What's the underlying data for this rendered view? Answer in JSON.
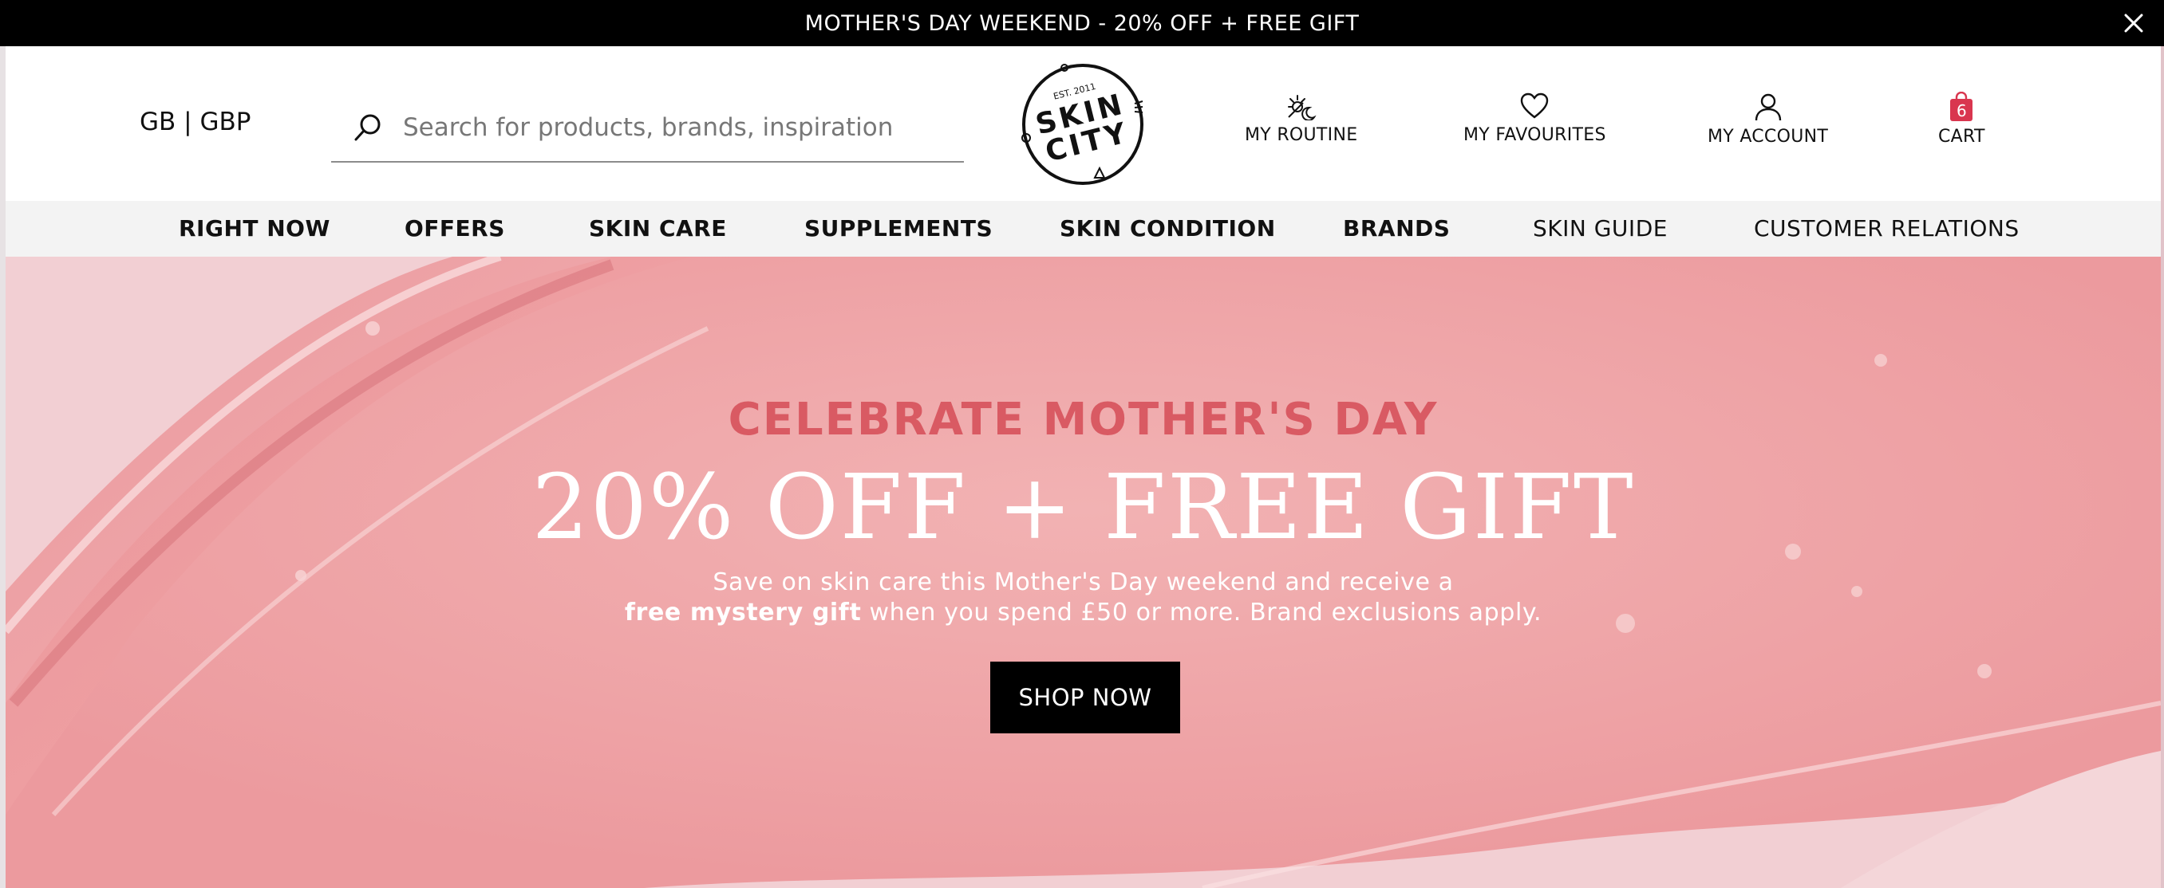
{
  "announcement": {
    "text": "MOTHER'S DAY WEEKEND - 20% OFF + FREE GIFT",
    "close_icon": "close-icon"
  },
  "header": {
    "locale": "GB | GBP",
    "search": {
      "placeholder": "Search for products, brands, inspiration",
      "value": "",
      "icon": "search-icon"
    },
    "logo": {
      "top_text": "EST. 2011",
      "line1": "SKIN",
      "line2": "CITY"
    },
    "links": {
      "routine": "MY ROUTINE",
      "favourites": "MY FAVOURITES",
      "account": "MY ACCOUNT",
      "cart": "CART"
    },
    "cart_count": "6",
    "icons": {
      "routine": "sun-moon-icon",
      "favourites": "heart-icon",
      "account": "user-icon",
      "cart": "shopping-bag-icon"
    }
  },
  "nav": {
    "items": [
      "RIGHT NOW",
      "OFFERS",
      "SKIN CARE",
      "SUPPLEMENTS",
      "SKIN CONDITION",
      "BRANDS",
      "SKIN GUIDE",
      "CUSTOMER RELATIONS"
    ]
  },
  "hero": {
    "eyebrow": "CELEBRATE MOTHER'S DAY",
    "headline": "20% OFF + FREE GIFT",
    "sub_line1": "Save on skin care this Mother's Day weekend and receive a",
    "sub_line2_bold": "free mystery gift",
    "sub_line2_rest": " when you spend £50 or more. Brand exclusions apply.",
    "cta": "SHOP NOW"
  },
  "colors": {
    "announcement_bg": "#000000",
    "nav_bg": "#f3f3f3",
    "eyebrow": "#d95a63",
    "cart_badge": "#d9364f",
    "hero_bg": "#f0c7c9"
  }
}
